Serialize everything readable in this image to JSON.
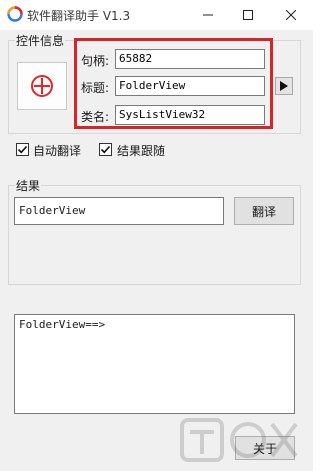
{
  "window": {
    "title": "软件翻译助手 V1.3",
    "app_icon": "app-logo-icon",
    "controls": {
      "minimize": "—",
      "maximize": "☐",
      "close": "✕"
    }
  },
  "control_info": {
    "group_label": "控件信息",
    "target_icon": "crosshair-target-icon",
    "fields": [
      {
        "label": "句柄:",
        "value": "65882"
      },
      {
        "label": "标题:",
        "value": "FolderView"
      },
      {
        "label": "类名:",
        "value": "SysListView32"
      }
    ],
    "expand_icon": "play-arrow-icon"
  },
  "options": {
    "auto_translate": {
      "label": "自动翻译",
      "checked": true
    },
    "result_follow": {
      "label": "结果跟随",
      "checked": true
    }
  },
  "result": {
    "group_label": "结果",
    "text": "FolderView",
    "translate_label": "翻译",
    "output": "FolderView==>"
  },
  "footer": {
    "close_label": "关于"
  },
  "colors": {
    "highlight": "#d8232a",
    "client_bg": "#f0f0f0",
    "target": "#e0282e"
  }
}
